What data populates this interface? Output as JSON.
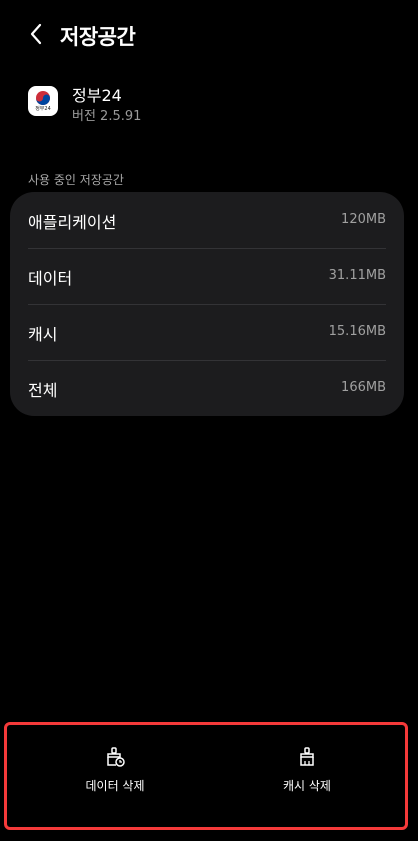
{
  "header": {
    "title": "저장공간"
  },
  "app": {
    "name": "정부24",
    "version": "버전 2.5.91",
    "icon_caption": "정부24"
  },
  "storage": {
    "section_label": "사용 중인 저장공간",
    "rows": [
      {
        "label": "애플리케이션",
        "value": "120MB"
      },
      {
        "label": "데이터",
        "value": "31.11MB"
      },
      {
        "label": "캐시",
        "value": "15.16MB"
      },
      {
        "label": "전체",
        "value": "166MB"
      }
    ]
  },
  "actions": {
    "clear_data_label": "데이터 삭제",
    "clear_cache_label": "캐시 삭제"
  },
  "colors": {
    "background": "#000000",
    "card": "#1c1c1e",
    "highlight_border": "#f53a3a"
  }
}
